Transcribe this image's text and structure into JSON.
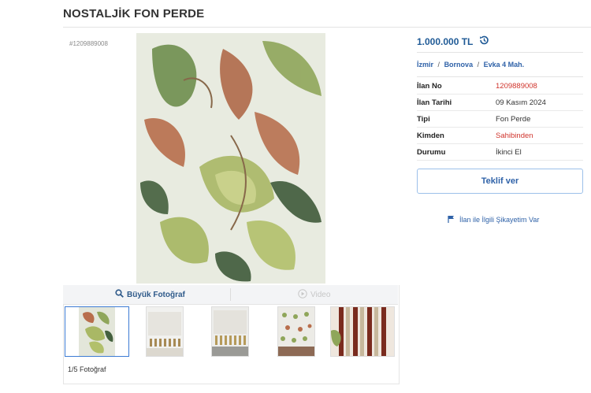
{
  "listing": {
    "title": "NOSTALJİK FON PERDE",
    "code": "#1209889008",
    "price": "1.000.000 TL"
  },
  "breadcrumb": [
    "İzmir",
    "Bornova",
    "Evka 4 Mah."
  ],
  "breadcrumb_sep": "/",
  "details": [
    {
      "label": "İlan No",
      "value": "1209889008"
    },
    {
      "label": "İlan Tarihi",
      "value": "09 Kasım 2024"
    },
    {
      "label": "Tipi",
      "value": "Fon Perde"
    },
    {
      "label": "Kimden",
      "value": "Sahibinden"
    },
    {
      "label": "Durumu",
      "value": "İkinci El"
    }
  ],
  "gallery": {
    "big_photo_label": "Büyük Fotoğraf",
    "video_label": "Video",
    "photo_count": "1/5 Fotoğraf"
  },
  "actions": {
    "offer_label": "Teklif ver",
    "complain_label": "İlan ile İlgili Şikayetim Var"
  },
  "icons": {
    "price_history": "history-icon",
    "search": "magnifier-icon",
    "video": "play-icon",
    "complain": "flag-icon"
  },
  "colors": {
    "accent": "#2f62a8",
    "red": "#d0342c"
  }
}
